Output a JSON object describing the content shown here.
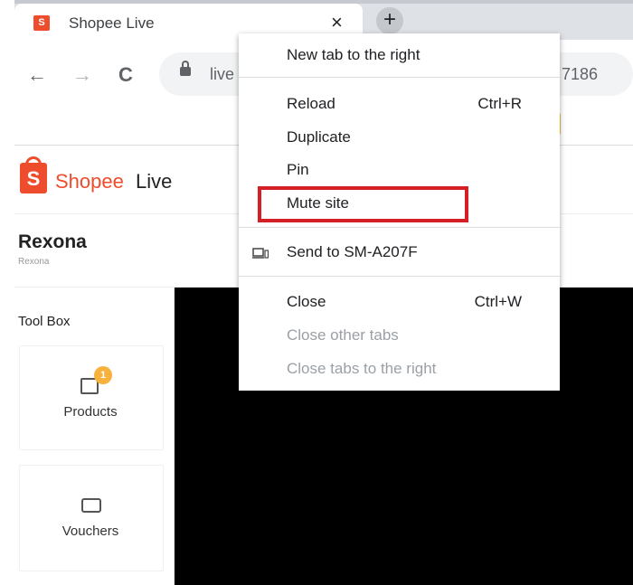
{
  "browser": {
    "tab": {
      "title": "Shopee Live",
      "favicon": "shopee-bag-icon",
      "close_glyph": "×"
    },
    "new_tab_glyph": "+",
    "nav": {
      "back_glyph": "←",
      "forward_glyph": "→",
      "reload_glyph": "C"
    },
    "address": {
      "visible_prefix": "live",
      "visible_suffix": "7186"
    }
  },
  "page": {
    "brand": {
      "icon_letter": "S",
      "word": "Shopee",
      "live": "Live",
      "color": "#ee4d2d"
    },
    "shop": {
      "name": "Rexona",
      "subtitle": "Rexona"
    },
    "toolbox": {
      "title": "Tool Box",
      "items": [
        {
          "label": "Products",
          "badge": "1",
          "icon": "shopping-bag-icon"
        },
        {
          "label": "Vouchers",
          "icon": "voucher-icon"
        }
      ]
    }
  },
  "context_menu": {
    "new_tab_right": "New tab to the right",
    "reload": {
      "label": "Reload",
      "shortcut": "Ctrl+R"
    },
    "duplicate": "Duplicate",
    "pin": "Pin",
    "mute_site": "Mute site",
    "send_to_device": {
      "label": "Send to SM-A207F",
      "icon": "device-icon"
    },
    "close": {
      "label": "Close",
      "shortcut": "Ctrl+W"
    },
    "close_other_tabs": "Close other tabs",
    "close_tabs_right": "Close tabs to the right",
    "highlight_color": "#d41f26"
  }
}
